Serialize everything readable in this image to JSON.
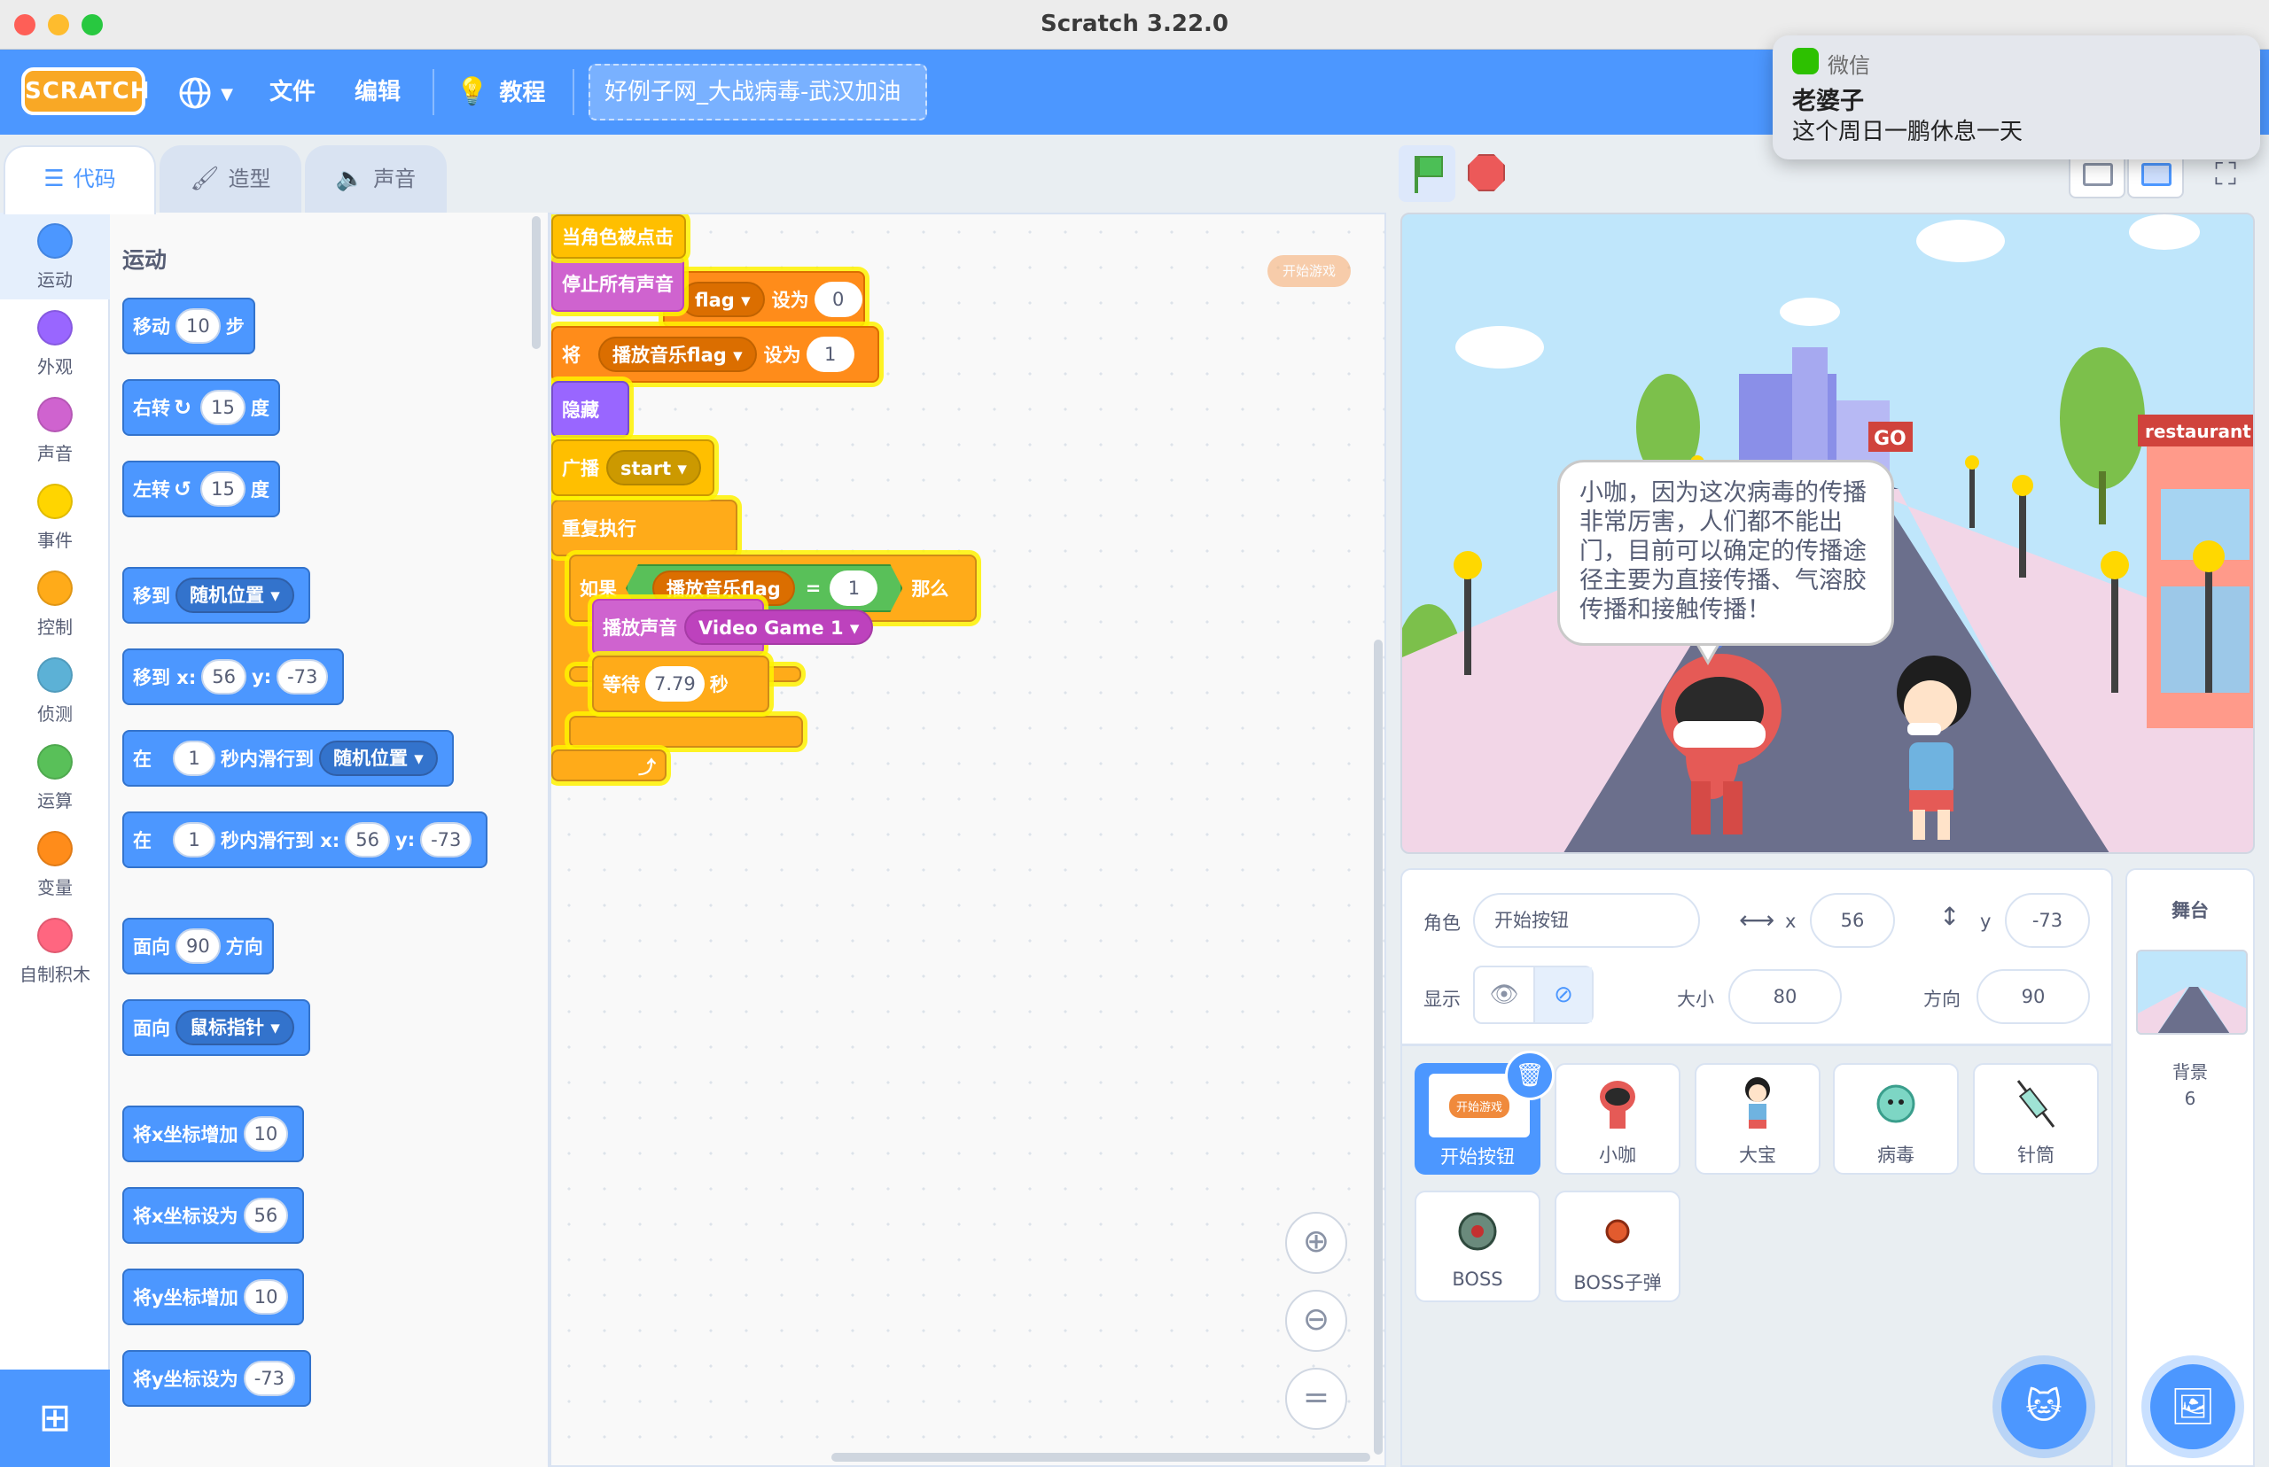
{
  "window": {
    "title": "Scratch 3.22.0"
  },
  "menubar": {
    "logo_text": "SCRATCH",
    "language_icon": "globe-icon",
    "file": "文件",
    "edit": "编辑",
    "tutorials": "教程",
    "project_title": "好例子网_大战病毒-武汉加油",
    "accent_color": "#4c97ff"
  },
  "notification": {
    "app": "微信",
    "title": "老婆子",
    "body": "这个周日一鹏休息一天"
  },
  "tabs": {
    "code": "代码",
    "costumes": "造型",
    "sounds": "声音"
  },
  "categories": [
    {
      "label": "运动",
      "color": "#4c97ff"
    },
    {
      "label": "外观",
      "color": "#9966ff"
    },
    {
      "label": "声音",
      "color": "#cf63cf"
    },
    {
      "label": "事件",
      "color": "#ffd500"
    },
    {
      "label": "控制",
      "color": "#ffab19"
    },
    {
      "label": "侦测",
      "color": "#5cb1d6"
    },
    {
      "label": "运算",
      "color": "#59c059"
    },
    {
      "label": "变量",
      "color": "#ff8c1a"
    },
    {
      "label": "自制积木",
      "color": "#ff6680"
    }
  ],
  "palette": {
    "heading": "运动",
    "move": {
      "a": "移动",
      "n": "10",
      "b": "步"
    },
    "turn_right": {
      "a": "右转",
      "n": "15",
      "b": "度"
    },
    "turn_left": {
      "a": "左转",
      "n": "15",
      "b": "度"
    },
    "goto": {
      "a": "移到",
      "d": "随机位置"
    },
    "goto_xy": {
      "a": "移到 x:",
      "x": "56",
      "yl": "y:",
      "y": "-73"
    },
    "glide": {
      "a": "在",
      "n": "1",
      "b": "秒内滑行到",
      "d": "随机位置"
    },
    "glide_xy": {
      "a": "在",
      "n": "1",
      "b": "秒内滑行到 x:",
      "x": "56",
      "yl": "y:",
      "y": "-73"
    },
    "point_dir": {
      "a": "面向",
      "n": "90",
      "b": "方向"
    },
    "point_towards": {
      "a": "面向",
      "d": "鼠标指针"
    },
    "change_x": {
      "a": "将x坐标增加",
      "n": "10"
    },
    "set_x": {
      "a": "将x坐标设为",
      "n": "56"
    },
    "change_y": {
      "a": "将y坐标增加",
      "n": "10"
    },
    "set_y": {
      "a": "将y坐标设为",
      "n": "-73"
    }
  },
  "script": {
    "hat": "当角色被点击",
    "stop_sounds": "停止所有声音",
    "set1": {
      "var": "flag",
      "label": "设为",
      "value": "0"
    },
    "set2": {
      "a": "将",
      "var": "播放音乐flag",
      "label": "设为",
      "value": "1"
    },
    "hide": "隐藏",
    "broadcast": {
      "a": "广播",
      "msg": "start"
    },
    "forever": "重复执行",
    "if": {
      "a": "如果",
      "var": "播放音乐flag",
      "op": "=",
      "value": "1",
      "then": "那么"
    },
    "play": {
      "a": "播放声音",
      "sound": "Video Game 1"
    },
    "wait": {
      "a": "等待",
      "value": "7.79",
      "b": "秒"
    },
    "ghost_button": "开始游戏"
  },
  "zoom": {
    "in": "zoom-in-icon",
    "out": "zoom-out-icon",
    "reset": "="
  },
  "stage": {
    "speech": "小咖，因为这次病毒的传播非常厉害，人们都不能出门，目前可以确定的传播途径主要为直接传播、气溶胶传播和接触传播！",
    "sign_go": "GO",
    "sign_restaurant": "restaurant"
  },
  "sprite_info": {
    "sprite_label": "角色",
    "sprite_name": "开始按钮",
    "x_label": "x",
    "x": "56",
    "y_label": "y",
    "y": "-73",
    "show_label": "显示",
    "size_label": "大小",
    "size": "80",
    "direction_label": "方向",
    "direction": "90"
  },
  "sprites": [
    {
      "name": "开始按钮",
      "thumb_text": "开始游戏"
    },
    {
      "name": "小咖"
    },
    {
      "name": "大宝"
    },
    {
      "name": "病毒"
    },
    {
      "name": "针筒"
    },
    {
      "name": "BOSS"
    },
    {
      "name": "BOSS子弹"
    }
  ],
  "stage_panel": {
    "title": "舞台",
    "backdrops_label": "背景",
    "backdrops_count": "6"
  }
}
